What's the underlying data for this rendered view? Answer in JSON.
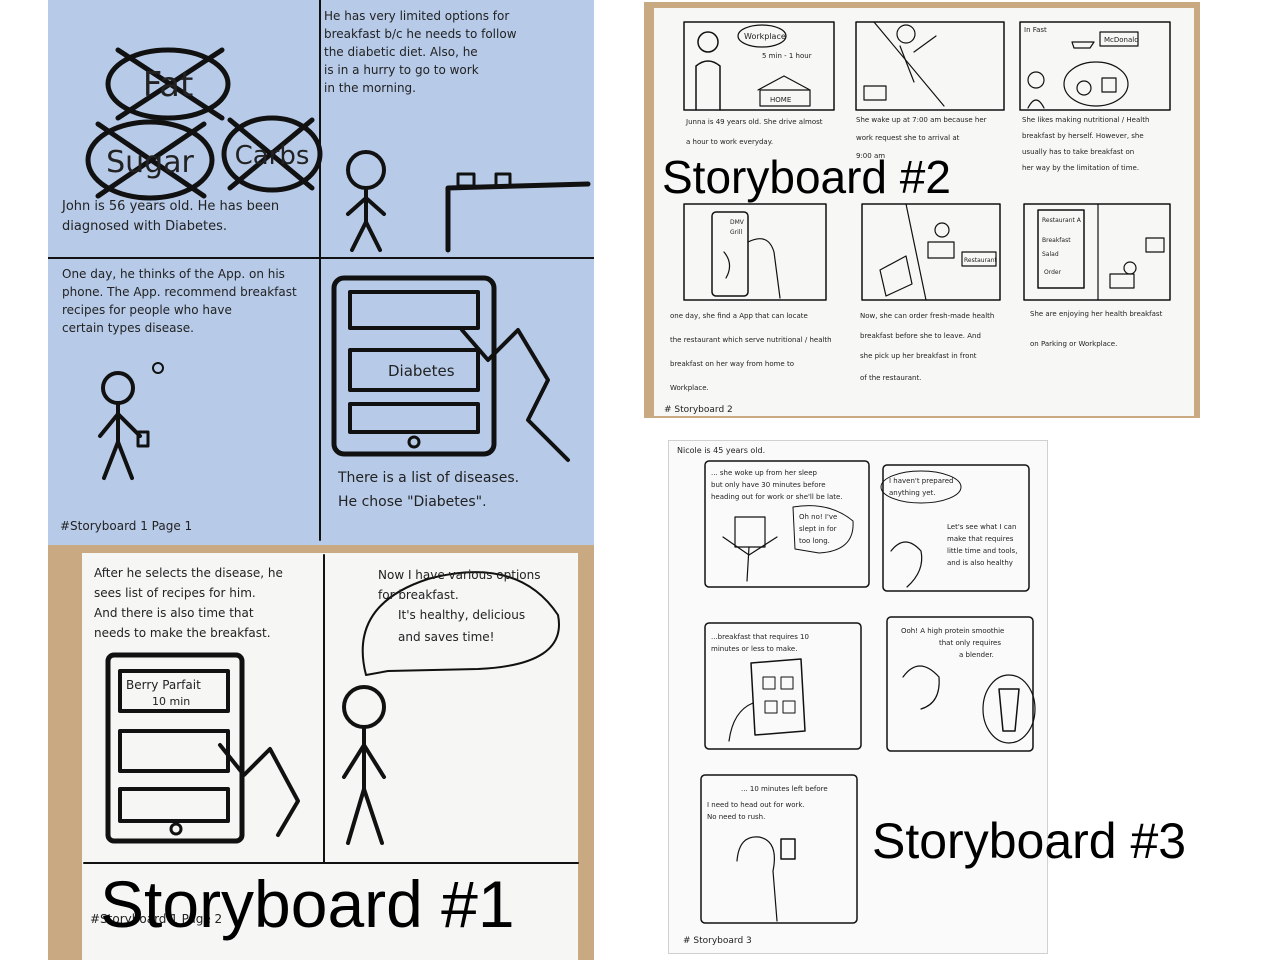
{
  "labels": {
    "sb1": "Storyboard #1",
    "sb2": "Storyboard #2",
    "sb3": "Storyboard #3"
  },
  "sb1_page1": {
    "p1_words": [
      "Fat",
      "Sugar",
      "Carbs"
    ],
    "p1_caption": [
      "John is 56 years old. He has been",
      "diagnosed with Diabetes."
    ],
    "p2_caption": [
      "He has very limited options for",
      "breakfast b/c he needs to follow",
      "the diabetic diet. Also, he",
      "is in a hurry to go to work",
      "in the morning."
    ],
    "p3_caption": [
      "One day, he thinks of the App. on his",
      "phone. The App. recommend breakfast",
      "recipes for people who have",
      "certain types disease."
    ],
    "p4_screen_label": "Diabetes",
    "p4_caption": [
      "There is a list of diseases.",
      "He chose \"Diabetes\"."
    ],
    "footer": "#Storyboard 1    Page 1"
  },
  "sb1_page2": {
    "p1_caption": [
      "After he selects the disease, he",
      "sees list of recipes for him.",
      "And there is also time that",
      "needs to make the breakfast."
    ],
    "p1_item": [
      "Berry Parfait",
      "10 min"
    ],
    "p2_speech": [
      "Now I have various options",
      "for breakfast.",
      "It's healthy, delicious",
      "and saves time!"
    ],
    "footer": "#Storyboard 1   Page 2"
  },
  "sb2": {
    "panel_captions": [
      [
        "Junna is 49 years old. She drive almost",
        "a hour to work everyday."
      ],
      [
        "She wake up at 7:00 am because her",
        "work request she to arrival at",
        "9:00 am"
      ],
      [
        "She likes making nutritional / Health",
        "breakfast by herself. However, she",
        "usually has to take breakfast on",
        "her way by the limitation of time."
      ],
      [
        "one day, she find a App that can locate",
        "the restaurant which serve nutritional / health",
        "breakfast on her way from home to",
        "Workplace."
      ],
      [
        "Now, she can order fresh-made health",
        "breakfast before she to leave. And",
        "she pick up her breakfast in front",
        "of the restaurant."
      ],
      [
        "She are enjoying her health breakfast",
        "on Parking or Workplace."
      ]
    ],
    "p1_bubble": "Workplace",
    "p1_time": "5 min - 1 hour",
    "p1_home": "HOME",
    "p3_infast": "In Fast",
    "p3_sign": "McDonald",
    "p4_phone_items": [
      "DMV",
      "Grill"
    ],
    "p5_sign": "Restaurant",
    "p6_menu": [
      "Restaurant A",
      "Breakfast",
      "Salad",
      "Order"
    ],
    "footer": "# Storyboard 2"
  },
  "sb3": {
    "header": "Nicole is 45 years old.",
    "p1_narration": [
      "... she woke up from her sleep",
      "but only have 30 minutes before",
      "heading out for work or she'll be late."
    ],
    "p1_speech": [
      "Oh no! I've",
      "slept in for",
      "too long."
    ],
    "p2_speech1": [
      "I haven't prepared",
      "anything yet."
    ],
    "p2_speech2": [
      "Let's see what I can",
      "make that requires",
      "little time and tools,",
      "and is also healthy"
    ],
    "p3_narration": [
      "...breakfast that requires 10",
      "minutes or less to make."
    ],
    "p4_speech": [
      "Ooh! A high protein smoothie",
      "that only requires",
      "a blender."
    ],
    "p5_narration": "... 10 minutes left before",
    "p5_speech": [
      "I need to head out for work.",
      "No need to rush."
    ],
    "footer": "# Storyboard 3"
  }
}
